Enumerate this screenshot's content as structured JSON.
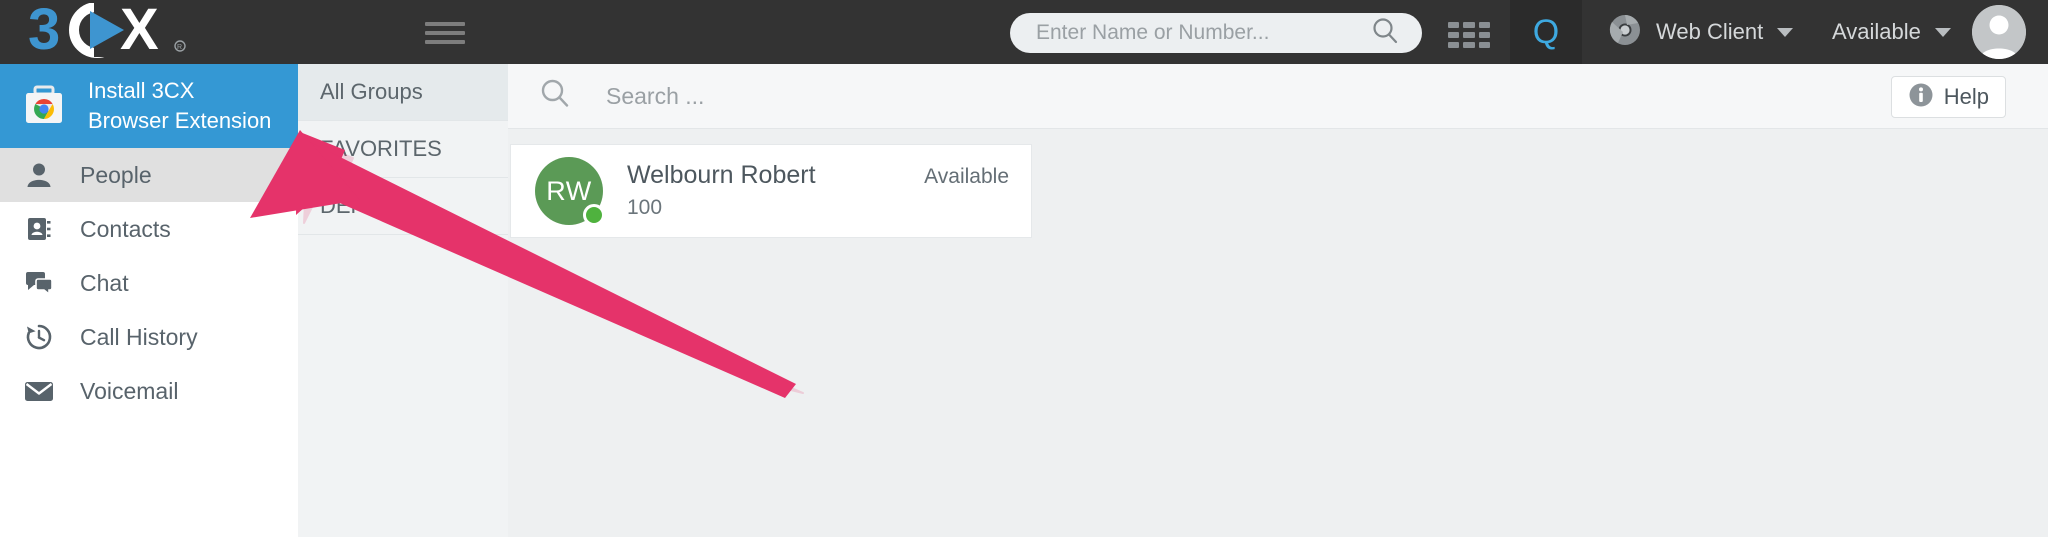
{
  "topbar": {
    "logo_text": "3CX",
    "menu_icon": "hamburger-icon",
    "search": {
      "placeholder": "Enter Name or Number...",
      "value": "",
      "icon": "search-icon"
    },
    "dialpad_icon": "grid-dialpad-icon",
    "quick_panel_label": "Q",
    "client_selector": {
      "label": "Web Client",
      "icon": "chrome-icon",
      "caret": "chevron-down-icon"
    },
    "presence_selector": {
      "label": "Available",
      "caret": "chevron-down-icon"
    },
    "avatar": "user-avatar"
  },
  "sidebar": {
    "banner": {
      "label": "Install 3CX Browser Extension",
      "icon": "chrome-web-store-icon"
    },
    "items": [
      {
        "label": "People",
        "icon": "person-icon",
        "selected": true
      },
      {
        "label": "Contacts",
        "icon": "address-book-icon",
        "selected": false
      },
      {
        "label": "Chat",
        "icon": "chat-bubbles-icon",
        "selected": false
      },
      {
        "label": "Call History",
        "icon": "clock-history-icon",
        "selected": false
      },
      {
        "label": "Voicemail",
        "icon": "envelope-icon",
        "selected": false
      }
    ]
  },
  "groups": {
    "items": [
      {
        "label": "All Groups",
        "selected": true
      },
      {
        "label": "FAVORITES",
        "selected": false
      },
      {
        "label": "DEFAULT",
        "selected": false
      }
    ]
  },
  "main": {
    "search": {
      "placeholder": "Search ...",
      "value": "",
      "icon": "search-icon"
    },
    "help_button": {
      "label": "Help",
      "icon": "info-icon"
    },
    "contacts": [
      {
        "initials": "RW",
        "name": "Welbourn Robert",
        "extension": "100",
        "status": "Available",
        "status_color": "#4fb23e",
        "avatar_color": "#5b9a56"
      }
    ]
  },
  "annotation": {
    "arrow": {
      "color": "#e5336a",
      "points_to": "install-3cx-browser-extension-banner"
    }
  },
  "colors": {
    "topbar_bg": "#333333",
    "accent_blue": "#3498d4",
    "logo_blue": "#3e95d0",
    "selected_gray": "#e0e0e0",
    "main_bg": "#eef0f1"
  }
}
